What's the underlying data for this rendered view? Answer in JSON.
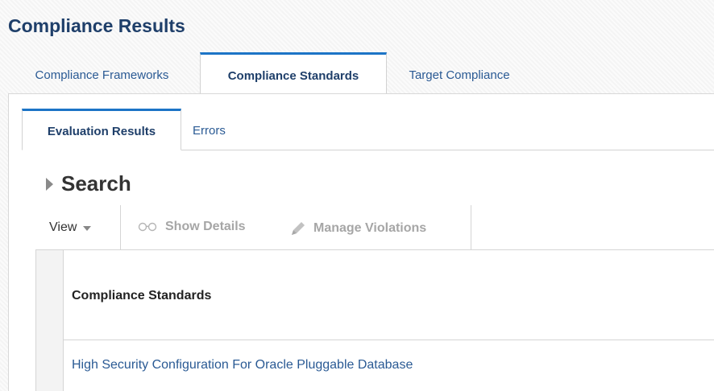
{
  "page": {
    "title": "Compliance Results"
  },
  "tabs": [
    {
      "label": "Compliance Frameworks",
      "active": false
    },
    {
      "label": "Compliance Standards",
      "active": true
    },
    {
      "label": "Target Compliance",
      "active": false
    }
  ],
  "subtabs": [
    {
      "label": "Evaluation Results",
      "active": true
    },
    {
      "label": "Errors",
      "active": false
    }
  ],
  "search": {
    "label": "Search",
    "expanded": false
  },
  "toolbar": {
    "view_label": "View",
    "show_details_label": "Show Details",
    "manage_violations_label": "Manage Violations"
  },
  "table": {
    "columns": [
      "Compliance Standards"
    ],
    "rows": [
      {
        "name": "High Security Configuration For Oracle Pluggable Database"
      }
    ]
  },
  "colors": {
    "title": "#1f3f6a",
    "link": "#2a5a94",
    "accent": "#1c74c6",
    "disabled": "#a6a6a6"
  }
}
